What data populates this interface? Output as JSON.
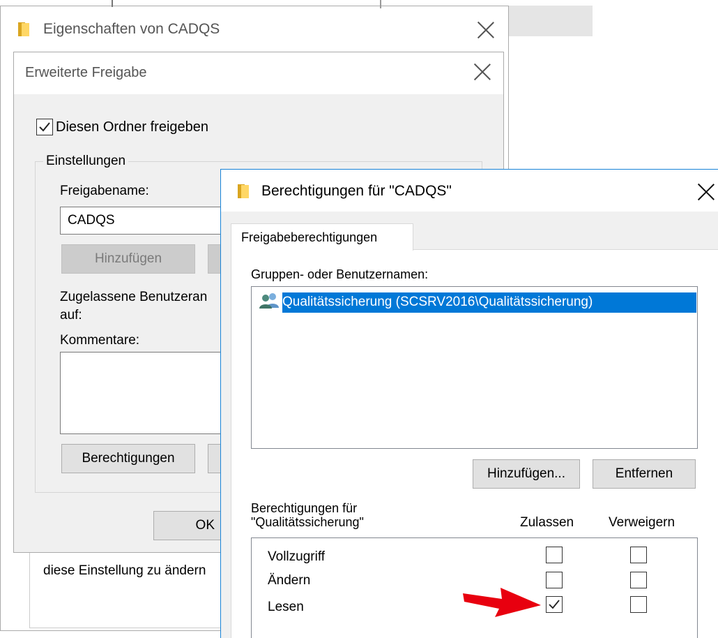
{
  "props_window": {
    "title": "Eigenschaften von CADQS",
    "partial_text": "diese Einstellung zu ändern"
  },
  "adv_dialog": {
    "title": "Erweiterte Freigabe",
    "share_checkbox_label": "Diesen Ordner freigeben",
    "share_checked": true,
    "settings_group_label": "Einstellungen",
    "share_name_label": "Freigabename:",
    "share_name_value": "CADQS",
    "add_button": "Hinzufügen",
    "limit_label_line1": "Zugelassene Benutzeran",
    "limit_label_line2": "auf:",
    "comments_label": "Kommentare:",
    "permissions_button": "Berechtigungen",
    "ok_button": "OK"
  },
  "perm_dialog": {
    "title": "Berechtigungen für \"CADQS\"",
    "tab_label": "Freigabeberechtigungen",
    "groups_label": "Gruppen- oder Benutzernamen:",
    "groups": [
      {
        "name": "Qualitätssicherung (SCSRV2016\\Qualitätssicherung)",
        "icon": "users-icon",
        "selected": true
      }
    ],
    "add_button": "Hinzufügen...",
    "remove_button": "Entfernen",
    "perms_for_line1": "Berechtigungen für",
    "perms_for_line2": "\"Qualitätssicherung\"",
    "col_allow": "Zulassen",
    "col_deny": "Verweigern",
    "permissions": [
      {
        "name": "Vollzugriff",
        "allow": false,
        "deny": false
      },
      {
        "name": "Ändern",
        "allow": false,
        "deny": false
      },
      {
        "name": "Lesen",
        "allow": true,
        "deny": false
      }
    ],
    "arrow_color": "#e8000f",
    "selection_color": "#0078d7"
  }
}
